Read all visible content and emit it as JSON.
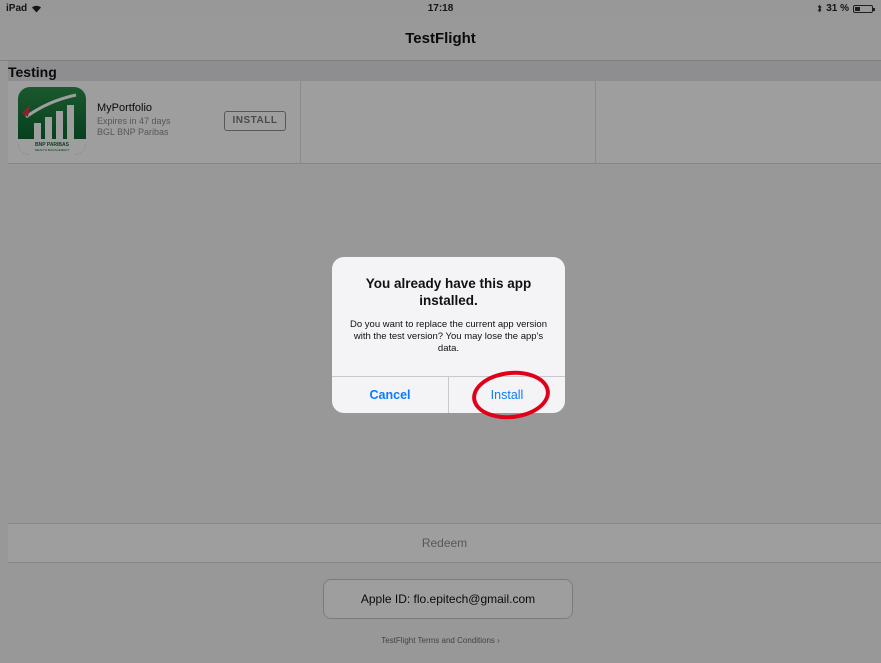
{
  "status_bar": {
    "device": "iPad",
    "time": "17:18",
    "battery": "31 %",
    "battery_level": 0.31
  },
  "nav": {
    "title": "TestFlight"
  },
  "section": {
    "title": "Testing"
  },
  "app": {
    "name": "MyPortfolio",
    "expires": "Expires in 47 days",
    "developer": "BGL BNP Paribas",
    "install_label": "INSTALL",
    "icon_caption": "BNP PARIBAS",
    "icon_subcaption": "WEALTH MANAGEMENT"
  },
  "redeem": {
    "label": "Redeem"
  },
  "account": {
    "apple_id": "Apple ID: flo.epitech@gmail.com"
  },
  "footer": {
    "terms": "TestFlight Terms and Conditions ›"
  },
  "alert": {
    "title": "You already have this app installed.",
    "message": "Do you want to replace the current app version with the test version? You may lose the app's data.",
    "cancel_label": "Cancel",
    "install_label": "Install"
  },
  "colors": {
    "accent": "#0a7cff",
    "annotation": "#e10019",
    "icon_green": "#0d6b34"
  }
}
